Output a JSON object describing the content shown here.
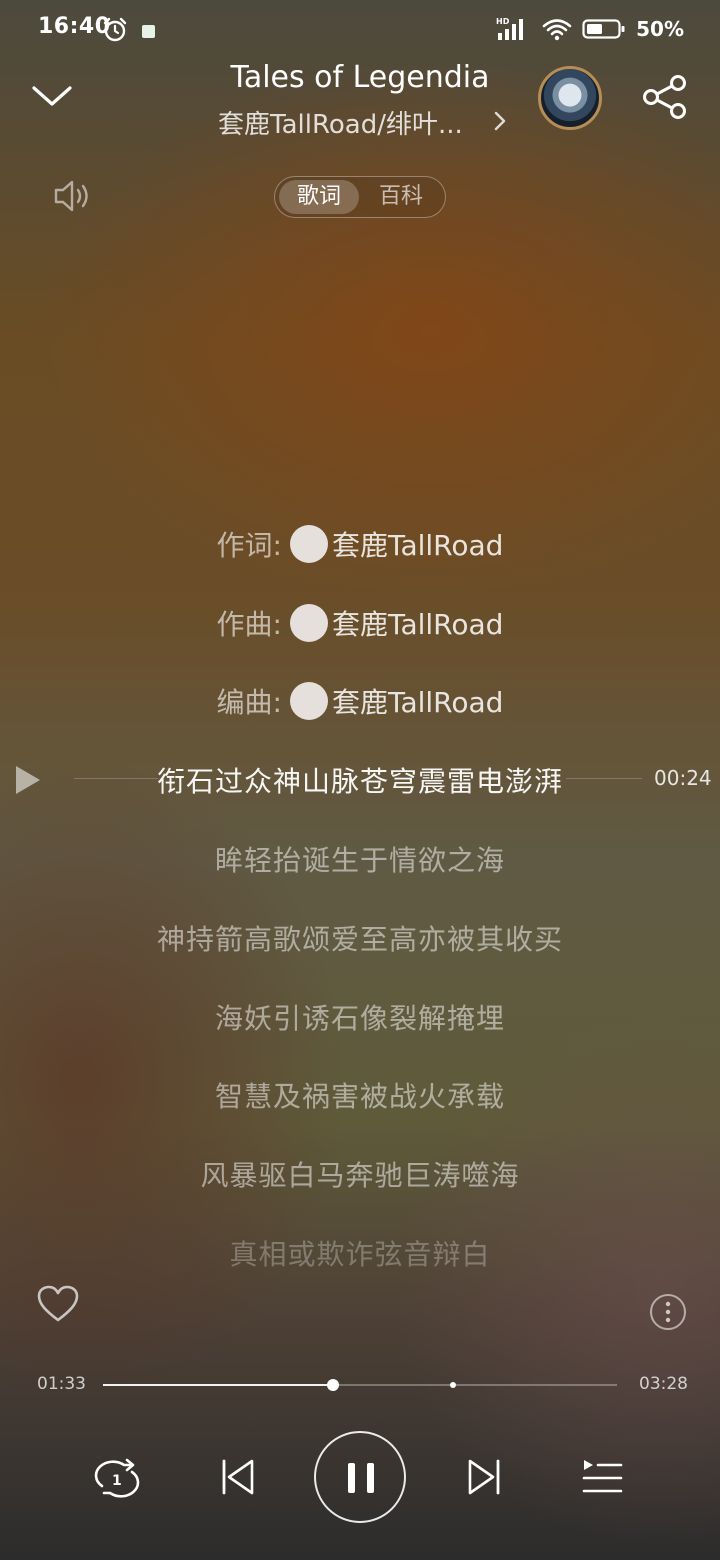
{
  "status_bar": {
    "time": "16:40",
    "battery": "50%",
    "network_label": "HD"
  },
  "header": {
    "title": "Tales of Legendia",
    "subtitle": "套鹿TallRoad/绯叶...",
    "tabs": [
      {
        "label": "歌词"
      },
      {
        "label": "百科"
      }
    ]
  },
  "credits": [
    {
      "label": "作词:",
      "name": "套鹿TallRoad"
    },
    {
      "label": "作曲:",
      "name": "套鹿TallRoad"
    },
    {
      "label": "编曲:",
      "name": "套鹿TallRoad"
    }
  ],
  "lyrics": [
    "衔石过众神山脉苍穹震雷电澎湃",
    "眸轻抬诞生于情欲之海",
    "神持箭高歌颂爱至高亦被其收买",
    "海妖引诱石像裂解掩埋",
    "智慧及祸害被战火承载",
    "风暴驱白马奔驰巨涛噬海",
    "真相或欺诈弦音辩白"
  ],
  "current_line_time": "00:24",
  "player": {
    "elapsed": "01:33",
    "duration": "03:28",
    "progress_fraction": 0.447,
    "marker_fraction": 0.68,
    "repeat_badge": "1"
  },
  "colors": {
    "accent": "#ffffff",
    "avatar_ring": "#b68d55"
  }
}
